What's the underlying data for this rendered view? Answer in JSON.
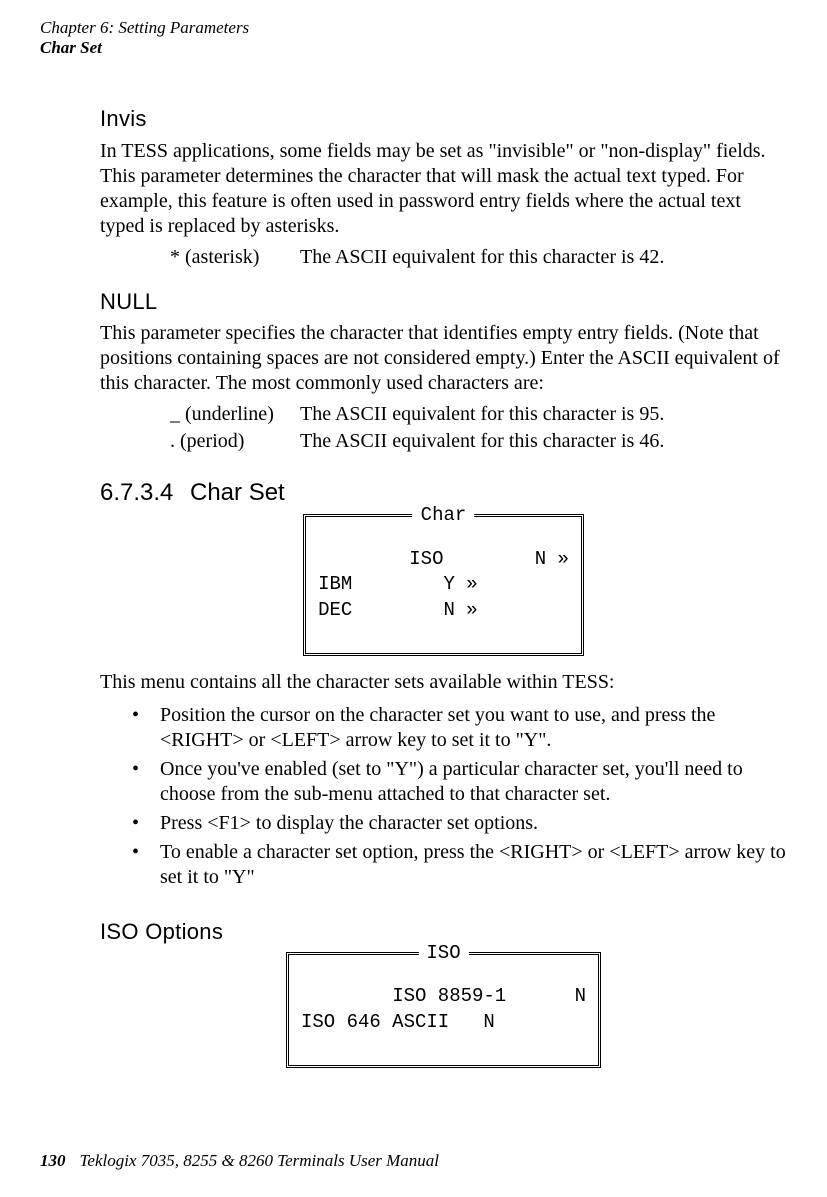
{
  "header": {
    "chapter_line": "Chapter  6:  Setting Parameters",
    "section_line": "Char Set"
  },
  "invis": {
    "title": "Invis",
    "para": "In TESS applications, some fields may be set as \"invisible\" or \"non-display\" fields. This parameter determines the character that will mask the actual text typed. For example, this feature is often used in password entry fields where the actual text typed is replaced by asterisks.",
    "row_label": "* (asterisk)",
    "row_text": "The ASCII equivalent for this character is 42."
  },
  "null": {
    "title": "NULL",
    "para": "This parameter specifies the character that identifies empty entry fields. (Note that positions containing spaces are not considered empty.) Enter the ASCII equivalent of this character. The most commonly used characters are:",
    "row1_label": "_ (underline)",
    "row1_text": "The ASCII equivalent for this character is 95.",
    "row2_label": ". (period)",
    "row2_text": "The ASCII equivalent for this character is 46."
  },
  "charset": {
    "section_number": "6.7.3.4",
    "section_title": "Char Set",
    "menu_title": "Char",
    "menu_lines": "ISO        N »\nIBM        Y »\nDEC        N »",
    "intro": "This menu contains all the character sets available within TESS:",
    "bullets": [
      "Position the cursor on the character set you want to use, and press the <RIGHT> or <LEFT> arrow key to set it to \"Y\".",
      "Once you've enabled (set to \"Y\") a particular character set, you'll need to choose from the sub-menu attached to that character set.",
      "Press <F1> to display the character set options.",
      "To enable a character set option, press the <RIGHT> or <LEFT> arrow key to set it to \"Y\""
    ]
  },
  "iso": {
    "title": "ISO Options",
    "menu_title": "ISO",
    "menu_lines": "ISO 8859-1      N\nISO 646 ASCII   N"
  },
  "footer": {
    "page": "130",
    "text": "Teklogix 7035, 8255 & 8260 Terminals User Manual"
  }
}
